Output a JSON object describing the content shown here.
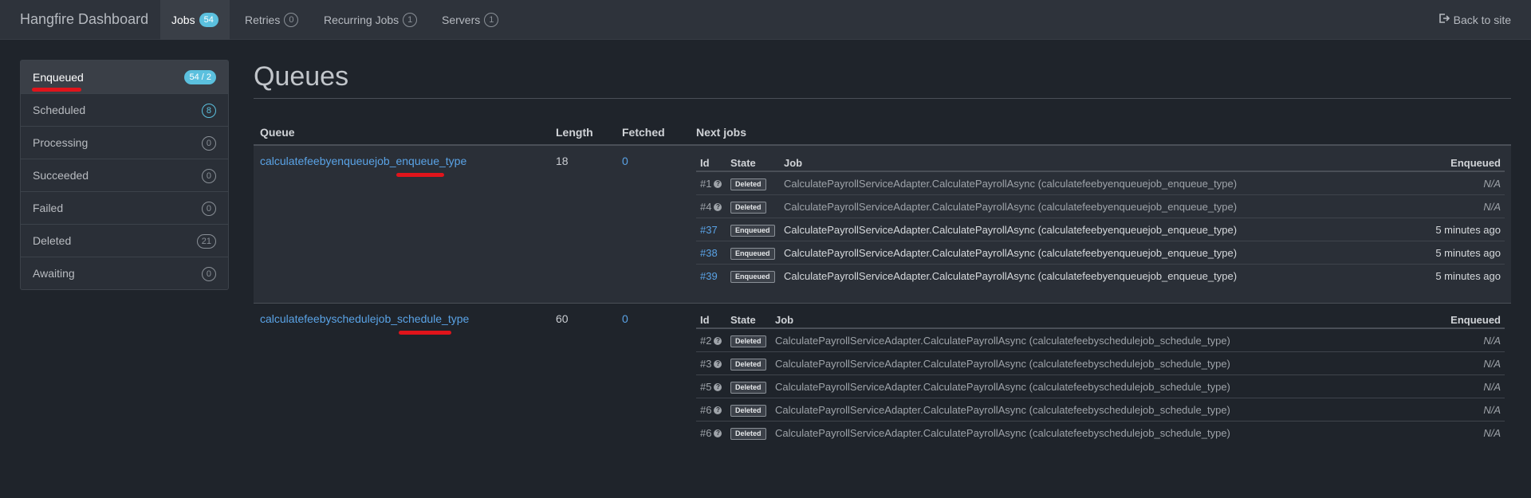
{
  "nav": {
    "brand": "Hangfire Dashboard",
    "items": [
      {
        "label": "Jobs",
        "count": "54",
        "active": true
      },
      {
        "label": "Retries",
        "count": "0"
      },
      {
        "label": "Recurring Jobs",
        "count": "1"
      },
      {
        "label": "Servers",
        "count": "1"
      }
    ],
    "back_label": "Back to site"
  },
  "sidebar": {
    "items": [
      {
        "label": "Enqueued",
        "count": "54 / 2",
        "active": true
      },
      {
        "label": "Scheduled",
        "count": "8"
      },
      {
        "label": "Processing",
        "count": "0"
      },
      {
        "label": "Succeeded",
        "count": "0"
      },
      {
        "label": "Failed",
        "count": "0"
      },
      {
        "label": "Deleted",
        "count": "21"
      },
      {
        "label": "Awaiting",
        "count": "0"
      }
    ]
  },
  "page": {
    "title": "Queues",
    "columns": {
      "queue": "Queue",
      "length": "Length",
      "fetched": "Fetched",
      "next_jobs": "Next jobs"
    }
  },
  "jobs_columns": {
    "id": "Id",
    "state": "State",
    "job": "Job",
    "enqueued": "Enqueued"
  },
  "queues": [
    {
      "name": "calculatefeebyenqueuejob_enqueue_type",
      "length": "18",
      "fetched": "0",
      "jobs": [
        {
          "id": "#1",
          "state": "Deleted",
          "job": "CalculatePayrollServiceAdapter.CalculatePayrollAsync (calculatefeebyenqueuejob_enqueue_type)",
          "enqueued": "N/A"
        },
        {
          "id": "#4",
          "state": "Deleted",
          "job": "CalculatePayrollServiceAdapter.CalculatePayrollAsync (calculatefeebyenqueuejob_enqueue_type)",
          "enqueued": "N/A"
        },
        {
          "id": "#37",
          "state": "Enqueued",
          "job": "CalculatePayrollServiceAdapter.CalculatePayrollAsync (calculatefeebyenqueuejob_enqueue_type)",
          "enqueued": "5 minutes ago"
        },
        {
          "id": "#38",
          "state": "Enqueued",
          "job": "CalculatePayrollServiceAdapter.CalculatePayrollAsync (calculatefeebyenqueuejob_enqueue_type)",
          "enqueued": "5 minutes ago"
        },
        {
          "id": "#39",
          "state": "Enqueued",
          "job": "CalculatePayrollServiceAdapter.CalculatePayrollAsync (calculatefeebyenqueuejob_enqueue_type)",
          "enqueued": "5 minutes ago"
        }
      ]
    },
    {
      "name": "calculatefeebyschedulejob_schedule_type",
      "length": "60",
      "fetched": "0",
      "jobs": [
        {
          "id": "#2",
          "state": "Deleted",
          "job": "CalculatePayrollServiceAdapter.CalculatePayrollAsync (calculatefeebyschedulejob_schedule_type)",
          "enqueued": "N/A"
        },
        {
          "id": "#3",
          "state": "Deleted",
          "job": "CalculatePayrollServiceAdapter.CalculatePayrollAsync (calculatefeebyschedulejob_schedule_type)",
          "enqueued": "N/A"
        },
        {
          "id": "#5",
          "state": "Deleted",
          "job": "CalculatePayrollServiceAdapter.CalculatePayrollAsync (calculatefeebyschedulejob_schedule_type)",
          "enqueued": "N/A"
        },
        {
          "id": "#6",
          "state": "Deleted",
          "job": "CalculatePayrollServiceAdapter.CalculatePayrollAsync (calculatefeebyschedulejob_schedule_type)",
          "enqueued": "N/A"
        },
        {
          "id": "#6",
          "state": "Deleted",
          "job": "CalculatePayrollServiceAdapter.CalculatePayrollAsync (calculatefeebyschedulejob_schedule_type)",
          "enqueued": "N/A"
        }
      ]
    }
  ],
  "colors": {
    "accent": "#5aa3e6",
    "badge": "#5bc0de",
    "annotation": "#e0141b"
  }
}
